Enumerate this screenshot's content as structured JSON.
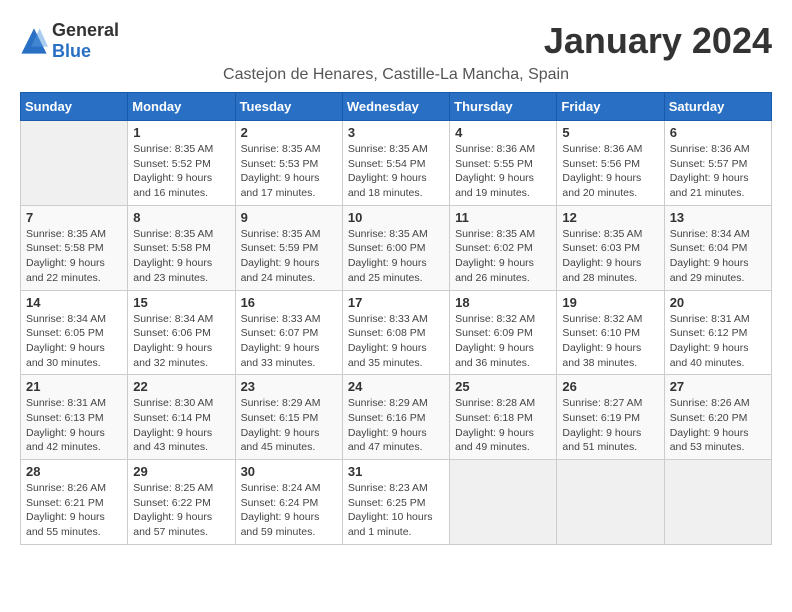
{
  "header": {
    "logo_general": "General",
    "logo_blue": "Blue",
    "month_title": "January 2024",
    "location": "Castejon de Henares, Castille-La Mancha, Spain"
  },
  "columns": [
    "Sunday",
    "Monday",
    "Tuesday",
    "Wednesday",
    "Thursday",
    "Friday",
    "Saturday"
  ],
  "weeks": [
    [
      {
        "day": "",
        "info": ""
      },
      {
        "day": "1",
        "info": "Sunrise: 8:35 AM\nSunset: 5:52 PM\nDaylight: 9 hours\nand 16 minutes."
      },
      {
        "day": "2",
        "info": "Sunrise: 8:35 AM\nSunset: 5:53 PM\nDaylight: 9 hours\nand 17 minutes."
      },
      {
        "day": "3",
        "info": "Sunrise: 8:35 AM\nSunset: 5:54 PM\nDaylight: 9 hours\nand 18 minutes."
      },
      {
        "day": "4",
        "info": "Sunrise: 8:36 AM\nSunset: 5:55 PM\nDaylight: 9 hours\nand 19 minutes."
      },
      {
        "day": "5",
        "info": "Sunrise: 8:36 AM\nSunset: 5:56 PM\nDaylight: 9 hours\nand 20 minutes."
      },
      {
        "day": "6",
        "info": "Sunrise: 8:36 AM\nSunset: 5:57 PM\nDaylight: 9 hours\nand 21 minutes."
      }
    ],
    [
      {
        "day": "7",
        "info": "Sunrise: 8:35 AM\nSunset: 5:58 PM\nDaylight: 9 hours\nand 22 minutes."
      },
      {
        "day": "8",
        "info": "Sunrise: 8:35 AM\nSunset: 5:58 PM\nDaylight: 9 hours\nand 23 minutes."
      },
      {
        "day": "9",
        "info": "Sunrise: 8:35 AM\nSunset: 5:59 PM\nDaylight: 9 hours\nand 24 minutes."
      },
      {
        "day": "10",
        "info": "Sunrise: 8:35 AM\nSunset: 6:00 PM\nDaylight: 9 hours\nand 25 minutes."
      },
      {
        "day": "11",
        "info": "Sunrise: 8:35 AM\nSunset: 6:02 PM\nDaylight: 9 hours\nand 26 minutes."
      },
      {
        "day": "12",
        "info": "Sunrise: 8:35 AM\nSunset: 6:03 PM\nDaylight: 9 hours\nand 28 minutes."
      },
      {
        "day": "13",
        "info": "Sunrise: 8:34 AM\nSunset: 6:04 PM\nDaylight: 9 hours\nand 29 minutes."
      }
    ],
    [
      {
        "day": "14",
        "info": "Sunrise: 8:34 AM\nSunset: 6:05 PM\nDaylight: 9 hours\nand 30 minutes."
      },
      {
        "day": "15",
        "info": "Sunrise: 8:34 AM\nSunset: 6:06 PM\nDaylight: 9 hours\nand 32 minutes."
      },
      {
        "day": "16",
        "info": "Sunrise: 8:33 AM\nSunset: 6:07 PM\nDaylight: 9 hours\nand 33 minutes."
      },
      {
        "day": "17",
        "info": "Sunrise: 8:33 AM\nSunset: 6:08 PM\nDaylight: 9 hours\nand 35 minutes."
      },
      {
        "day": "18",
        "info": "Sunrise: 8:32 AM\nSunset: 6:09 PM\nDaylight: 9 hours\nand 36 minutes."
      },
      {
        "day": "19",
        "info": "Sunrise: 8:32 AM\nSunset: 6:10 PM\nDaylight: 9 hours\nand 38 minutes."
      },
      {
        "day": "20",
        "info": "Sunrise: 8:31 AM\nSunset: 6:12 PM\nDaylight: 9 hours\nand 40 minutes."
      }
    ],
    [
      {
        "day": "21",
        "info": "Sunrise: 8:31 AM\nSunset: 6:13 PM\nDaylight: 9 hours\nand 42 minutes."
      },
      {
        "day": "22",
        "info": "Sunrise: 8:30 AM\nSunset: 6:14 PM\nDaylight: 9 hours\nand 43 minutes."
      },
      {
        "day": "23",
        "info": "Sunrise: 8:29 AM\nSunset: 6:15 PM\nDaylight: 9 hours\nand 45 minutes."
      },
      {
        "day": "24",
        "info": "Sunrise: 8:29 AM\nSunset: 6:16 PM\nDaylight: 9 hours\nand 47 minutes."
      },
      {
        "day": "25",
        "info": "Sunrise: 8:28 AM\nSunset: 6:18 PM\nDaylight: 9 hours\nand 49 minutes."
      },
      {
        "day": "26",
        "info": "Sunrise: 8:27 AM\nSunset: 6:19 PM\nDaylight: 9 hours\nand 51 minutes."
      },
      {
        "day": "27",
        "info": "Sunrise: 8:26 AM\nSunset: 6:20 PM\nDaylight: 9 hours\nand 53 minutes."
      }
    ],
    [
      {
        "day": "28",
        "info": "Sunrise: 8:26 AM\nSunset: 6:21 PM\nDaylight: 9 hours\nand 55 minutes."
      },
      {
        "day": "29",
        "info": "Sunrise: 8:25 AM\nSunset: 6:22 PM\nDaylight: 9 hours\nand 57 minutes."
      },
      {
        "day": "30",
        "info": "Sunrise: 8:24 AM\nSunset: 6:24 PM\nDaylight: 9 hours\nand 59 minutes."
      },
      {
        "day": "31",
        "info": "Sunrise: 8:23 AM\nSunset: 6:25 PM\nDaylight: 10 hours\nand 1 minute."
      },
      {
        "day": "",
        "info": ""
      },
      {
        "day": "",
        "info": ""
      },
      {
        "day": "",
        "info": ""
      }
    ]
  ]
}
